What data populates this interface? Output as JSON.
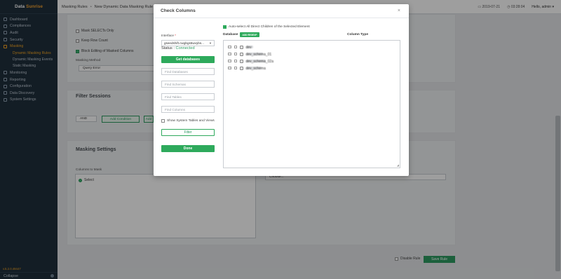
{
  "sidebar": {
    "brand_a": "Data",
    "brand_b": "Sunrise",
    "items": [
      {
        "label": "Dashboard",
        "active": false
      },
      {
        "label": "Compliances",
        "active": false
      },
      {
        "label": "Audit",
        "active": false
      },
      {
        "label": "Security",
        "active": false
      },
      {
        "label": "Masking",
        "active": true
      }
    ],
    "masking_subitems": [
      {
        "label": "Dynamic Masking Rules",
        "active": true
      },
      {
        "label": "Dynamic Masking Events",
        "active": false
      },
      {
        "label": "Static Masking",
        "active": false
      }
    ],
    "items_after": [
      {
        "label": "Monitoring"
      },
      {
        "label": "Reporting"
      },
      {
        "label": "Configuration"
      },
      {
        "label": "Data Discovery"
      },
      {
        "label": "System Settings"
      }
    ],
    "version": "v.5.2.0.49447",
    "collapse_label": "Collapse"
  },
  "header": {
    "crumb_1": "Masking Rules",
    "crumb_sep": "•",
    "crumb_2": "New Dynamic Data Masking Rule",
    "date": "2019-07-21",
    "time": "03:28:04",
    "user": "Hello, admin"
  },
  "background": {
    "checks": [
      {
        "label": "Mask SELECTs Only",
        "checked": false
      },
      {
        "label": "Keep Row Count",
        "checked": false
      },
      {
        "label": "Block Editing of Masked Columns",
        "checked": true
      }
    ],
    "masking_method_label": "Masking Method",
    "masking_method_value": "Query Error",
    "filter_title": "Filter Sessions",
    "filter_op": "AND",
    "add_condition": "Add Condition",
    "add_group": "Add",
    "masking_settings_title": "Masking Settings",
    "columns_to_mask": "Columns to Mask",
    "select_label": "Select",
    "choose_label": "Choose...",
    "disable_rule": "Disable Rule",
    "save_rule": "Save Rule"
  },
  "modal": {
    "title": "Check Columns",
    "close": "×",
    "status_label": "Status : ",
    "status_value": "Connected",
    "interface_label": "Interface",
    "interface_required": "*",
    "interface_value": "gseedshift.cwgbgs5wvybs...",
    "get_databases": "Get databases",
    "find_databases": "Find Databases",
    "find_schemas": "Find Schemas",
    "find_tables": "Find Tables",
    "find_columns": "Find Columns",
    "show_system": "Show System Tables and Views",
    "filter": "Filter",
    "done": "Done",
    "auto_select": "Auto-select All Direct Children of the Selected Element",
    "database_header": "Database",
    "add_badge": "ADD REGEXP",
    "column_type_header": "Column Type",
    "tree_rows": [
      {
        "label": "dev"
      },
      {
        "label": "dev_schema_01"
      },
      {
        "label": "dev_schema_02a"
      },
      {
        "label": "dev_schema"
      }
    ]
  }
}
